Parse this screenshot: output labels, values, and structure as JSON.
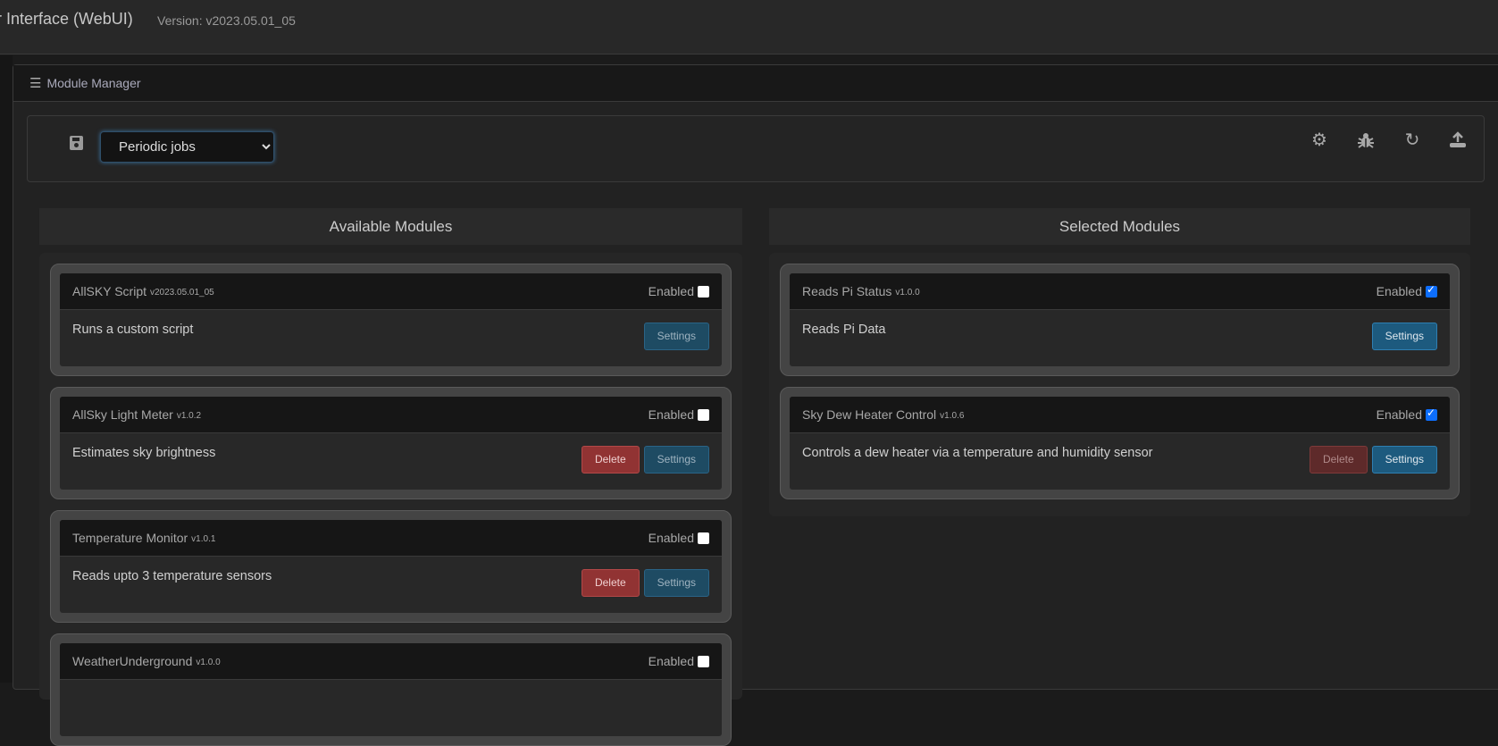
{
  "header": {
    "title": "r Interface (WebUI)",
    "version": "Version: v2023.05.01_05"
  },
  "panel": {
    "title": "Module Manager"
  },
  "toolbar": {
    "selected_flow": "Periodic jobs",
    "icons": [
      "save-icon",
      "gear-icon",
      "bug-icon",
      "refresh-icon",
      "upload-icon"
    ]
  },
  "available": {
    "heading": "Available Modules",
    "modules": [
      {
        "name": "AllSKY Script",
        "version": "v2023.05.01_05",
        "enabled_label": "Enabled",
        "enabled": false,
        "description": "Runs a custom script",
        "delete": null,
        "settings": "Settings"
      },
      {
        "name": "AllSky Light Meter",
        "version": "v1.0.2",
        "enabled_label": "Enabled",
        "enabled": false,
        "description": "Estimates sky brightness",
        "delete": "Delete",
        "settings": "Settings"
      },
      {
        "name": "Temperature Monitor",
        "version": "v1.0.1",
        "enabled_label": "Enabled",
        "enabled": false,
        "description": "Reads upto 3 temperature sensors",
        "delete": "Delete",
        "settings": "Settings"
      },
      {
        "name": "WeatherUnderground",
        "version": "v1.0.0",
        "enabled_label": "Enabled",
        "enabled": false,
        "description": "",
        "delete": null,
        "settings": null
      }
    ]
  },
  "selected": {
    "heading": "Selected Modules",
    "modules": [
      {
        "name": "Reads Pi Status",
        "version": "v1.0.0",
        "enabled_label": "Enabled",
        "enabled": true,
        "description": "Reads Pi Data",
        "delete": null,
        "settings": "Settings"
      },
      {
        "name": "Sky Dew Heater Control",
        "version": "v1.0.6",
        "enabled_label": "Enabled",
        "enabled": true,
        "description": "Controls a dew heater via a temperature and humidity sensor",
        "delete": "Delete",
        "settings": "Settings"
      }
    ]
  }
}
